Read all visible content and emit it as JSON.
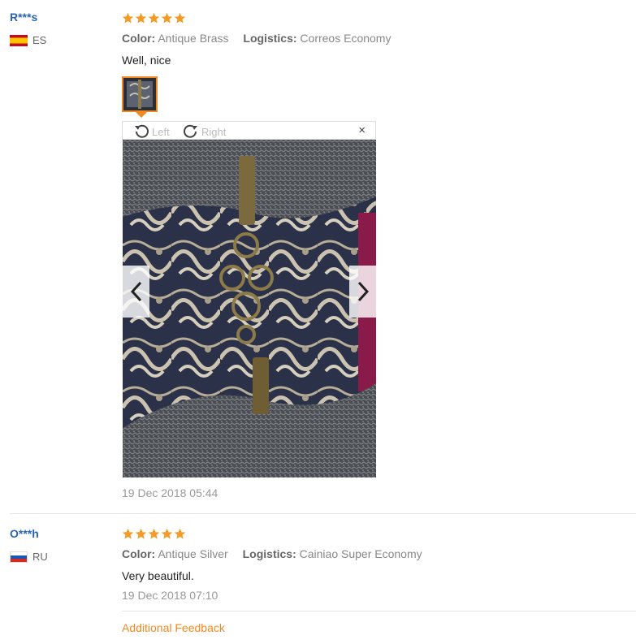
{
  "reviews": [
    {
      "user": "R***s",
      "country": "ES",
      "rating": 5,
      "color_label": "Color:",
      "color_value": "Antique Brass",
      "logistics_label": "Logistics:",
      "logistics_value": "Correos Economy",
      "text": "Well, nice",
      "date": "19 Dec 2018 05:44",
      "viewer": {
        "rotate_left": "Left",
        "rotate_right": "Right",
        "close": "×"
      }
    },
    {
      "user": "O***h",
      "country": "RU",
      "rating": 5,
      "color_label": "Color:",
      "color_value": "Antique Silver",
      "logistics_label": "Logistics:",
      "logistics_value": "Cainiao Super Economy",
      "text": "Very beautiful.",
      "date": "19 Dec 2018 07:10"
    }
  ],
  "additional_feedback": "Additional Feedback",
  "colors": {
    "star": "#f59a23",
    "username": "#2a64b4",
    "accent": "#f08a24"
  }
}
